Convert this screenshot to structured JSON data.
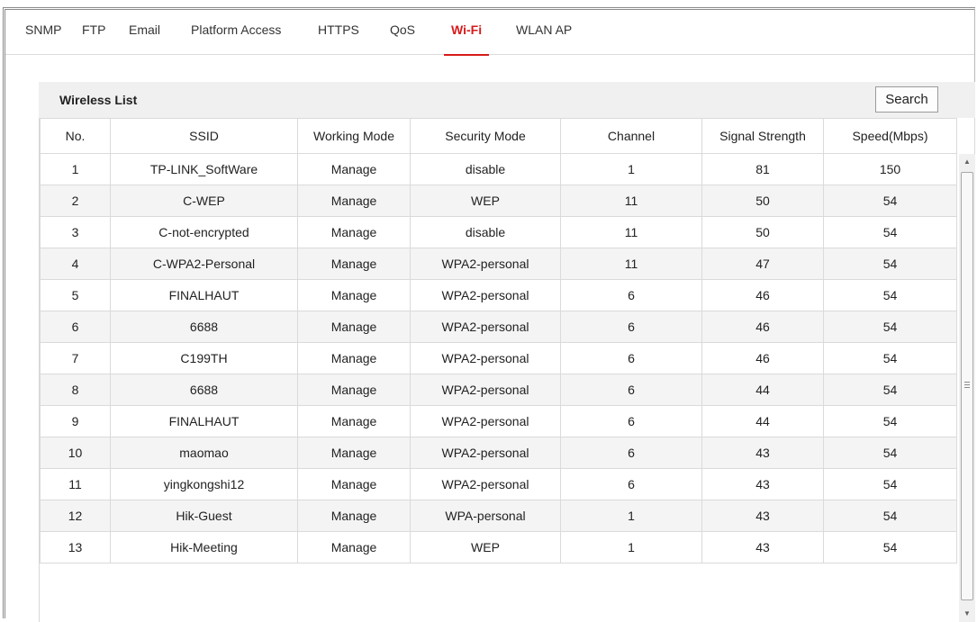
{
  "tabs": [
    {
      "label": "SNMP"
    },
    {
      "label": "FTP"
    },
    {
      "label": "Email"
    },
    {
      "label": "Platform Access"
    },
    {
      "label": "HTTPS"
    },
    {
      "label": "QoS"
    },
    {
      "label": "Wi-Fi",
      "active": true
    },
    {
      "label": "WLAN AP"
    }
  ],
  "panel": {
    "title": "Wireless List",
    "search_label": "Search"
  },
  "table": {
    "columns": [
      "No.",
      "SSID",
      "Working Mode",
      "Security Mode",
      "Channel",
      "Signal Strength",
      "Speed(Mbps)"
    ],
    "rows": [
      [
        "1",
        "TP-LINK_SoftWare",
        "Manage",
        "disable",
        "1",
        "81",
        "150"
      ],
      [
        "2",
        "C-WEP",
        "Manage",
        "WEP",
        "11",
        "50",
        "54"
      ],
      [
        "3",
        "C-not-encrypted",
        "Manage",
        "disable",
        "11",
        "50",
        "54"
      ],
      [
        "4",
        "C-WPA2-Personal",
        "Manage",
        "WPA2-personal",
        "11",
        "47",
        "54"
      ],
      [
        "5",
        "FINALHAUT",
        "Manage",
        "WPA2-personal",
        "6",
        "46",
        "54"
      ],
      [
        "6",
        "6688",
        "Manage",
        "WPA2-personal",
        "6",
        "46",
        "54"
      ],
      [
        "7",
        "C199TH",
        "Manage",
        "WPA2-personal",
        "6",
        "46",
        "54"
      ],
      [
        "8",
        "6688",
        "Manage",
        "WPA2-personal",
        "6",
        "44",
        "54"
      ],
      [
        "9",
        "FINALHAUT",
        "Manage",
        "WPA2-personal",
        "6",
        "44",
        "54"
      ],
      [
        "10",
        "maomao",
        "Manage",
        "WPA2-personal",
        "6",
        "43",
        "54"
      ],
      [
        "11",
        "yingkongshi12",
        "Manage",
        "WPA2-personal",
        "6",
        "43",
        "54"
      ],
      [
        "12",
        "Hik-Guest",
        "Manage",
        "WPA-personal",
        "1",
        "43",
        "54"
      ],
      [
        "13",
        "Hik-Meeting",
        "Manage",
        "WEP",
        "1",
        "43",
        "54"
      ]
    ]
  },
  "scrollbar": {
    "up_icon": "arrow-up-icon",
    "down_icon": "arrow-down-icon"
  },
  "colors": {
    "active_tab": "#d71a1a",
    "header_bg": "#f0f0f0",
    "row_alt_bg": "#f4f4f4"
  }
}
